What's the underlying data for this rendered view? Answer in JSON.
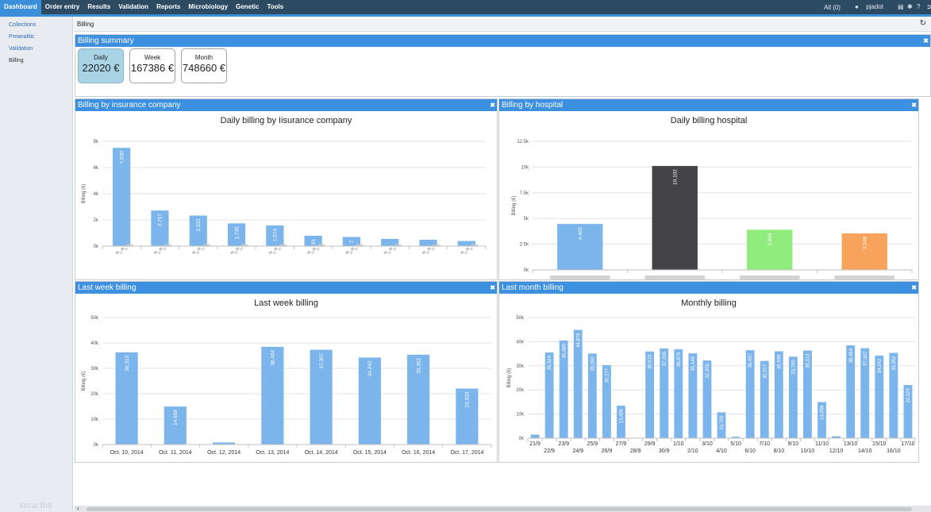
{
  "nav": {
    "items": [
      "Dashboard",
      "Order entry",
      "Results",
      "Validation",
      "Reports",
      "Microbiology",
      "Genetic",
      "Tools"
    ],
    "active": 0,
    "filter_label": "All (0)",
    "username": "pjadot"
  },
  "sidebar": {
    "items": [
      "Collections",
      "Preanalitic",
      "Validation",
      "Billing"
    ],
    "current": 3,
    "brand": "smartlis"
  },
  "breadcrumb": "Billing",
  "summary": {
    "title": "Billing summary",
    "tiles": [
      {
        "label": "Daily",
        "value": "22020 €",
        "selected": true
      },
      {
        "label": "Week",
        "value": "167386 €",
        "selected": false
      },
      {
        "label": "Month",
        "value": "748660 €",
        "selected": false
      }
    ]
  },
  "panels": {
    "insurance": "Billing by insurance company",
    "hospital": "Billing by hospital",
    "week": "Last week billing",
    "month": "Last month billing"
  },
  "colors": {
    "bar": "#7cb5ec",
    "hospital": [
      "#7cb5ec",
      "#434348",
      "#90ed7d",
      "#f7a35c"
    ],
    "panel_header": "#3d8fdf"
  },
  "chart_data": [
    {
      "type": "bar",
      "title": "Daily billing by Iisurance company",
      "ylabel": "Billing (€)",
      "ylim": [
        0,
        8000
      ],
      "yticks": [
        "0k",
        "2k",
        "4k",
        "6k",
        "8k"
      ],
      "categories": [
        "",
        "",
        "",
        "",
        "",
        "",
        "",
        "",
        "",
        ""
      ],
      "values": [
        7500,
        2717,
        2332,
        1735,
        1574,
        791,
        697,
        547,
        487,
        387
      ],
      "data_labels": [
        "7,500",
        "2,717",
        "2,332",
        "1,735",
        "1,574",
        "91",
        "7",
        "",
        "",
        ""
      ]
    },
    {
      "type": "bar",
      "title": "Daily billing hospital",
      "ylabel": "Billing (€)",
      "ylim": [
        0,
        12500
      ],
      "yticks": [
        "0k",
        "2.5k",
        "5k",
        "7.5k",
        "10k",
        "12.5k"
      ],
      "categories": [
        "",
        "",
        "",
        ""
      ],
      "values": [
        4465,
        10102,
        3904,
        3548
      ],
      "data_labels": [
        "4,465",
        "10,102",
        "3,904",
        "3,548"
      ]
    },
    {
      "type": "bar",
      "title": "Last week billing",
      "ylabel": "Billing (€)",
      "ylim": [
        0,
        50000
      ],
      "yticks": [
        "0k",
        "10k",
        "20k",
        "30k",
        "40k",
        "50k"
      ],
      "categories": [
        "Oct. 10, 2014",
        "Oct. 11, 2014",
        "Oct. 12, 2014",
        "Oct. 13, 2014",
        "Oct. 14, 2014",
        "Oct. 15, 2014",
        "Oct. 16, 2014",
        "Oct. 17, 2014"
      ],
      "values": [
        36313,
        14958,
        800,
        38464,
        37307,
        34242,
        35352,
        22020
      ],
      "data_labels": [
        "36,313",
        "14,958",
        "",
        "38,464",
        "37,307",
        "34,242",
        "35,352",
        "22,020"
      ]
    },
    {
      "type": "bar",
      "title": "Monthly billing",
      "ylabel": "Billing (€)",
      "ylim": [
        0,
        50000
      ],
      "yticks": [
        "0k",
        "10k",
        "20k",
        "30k",
        "40k",
        "50k"
      ],
      "categories": [
        "21/9",
        "22/9",
        "23/9",
        "24/9",
        "25/9",
        "26/9",
        "27/9",
        "28/9",
        "29/9",
        "30/9",
        "1/10",
        "2/10",
        "3/10",
        "4/10",
        "5/10",
        "6/10",
        "7/10",
        "8/10",
        "9/10",
        "10/10",
        "11/10",
        "12/10",
        "13/10",
        "14/10",
        "15/10",
        "16/10",
        "17/10"
      ],
      "values": [
        1500,
        35524,
        40480,
        44878,
        35090,
        30277,
        13456,
        200,
        35919,
        37205,
        36875,
        35149,
        32205,
        10709,
        600,
        36457,
        32017,
        35999,
        33790,
        36313,
        14958,
        800,
        38464,
        37307,
        34242,
        35352,
        22020
      ],
      "data_labels": [
        "",
        "35,524",
        "40,480",
        "44,878",
        "35,090",
        "30,277",
        "13,456",
        "",
        "35,919",
        "37,205",
        "36,875",
        "35,149",
        "32,205",
        "10,709",
        "",
        "36,457",
        "32,017",
        "35,999",
        "33,790",
        "36,313",
        "14,958",
        "",
        "38,464",
        "37,307",
        "34,242",
        "35,352",
        "22,020"
      ]
    }
  ]
}
